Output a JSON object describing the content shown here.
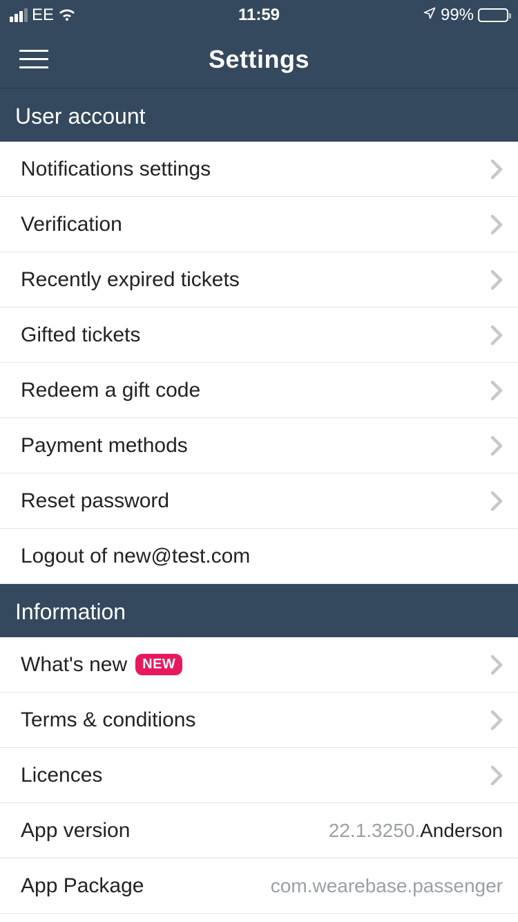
{
  "status": {
    "carrier": "EE",
    "time": "11:59",
    "battery_pct": "99%"
  },
  "nav": {
    "title": "Settings"
  },
  "sections": {
    "user_account": {
      "header": "User account",
      "items": {
        "notifications": "Notifications settings",
        "verification": "Verification",
        "recently_expired": "Recently expired tickets",
        "gifted": "Gifted tickets",
        "redeem": "Redeem a gift code",
        "payment": "Payment methods",
        "reset_pw": "Reset password",
        "logout": "Logout of new@test.com"
      }
    },
    "information": {
      "header": "Information",
      "items": {
        "whats_new": "What's new",
        "whats_new_badge": "NEW",
        "terms": "Terms & conditions",
        "licences": "Licences",
        "app_version_label": "App version",
        "app_version_value_gray": "22.1.3250.",
        "app_version_value_dark": "Anderson",
        "app_package_label": "App Package",
        "app_package_value": "com.wearebase.passenger"
      }
    }
  }
}
